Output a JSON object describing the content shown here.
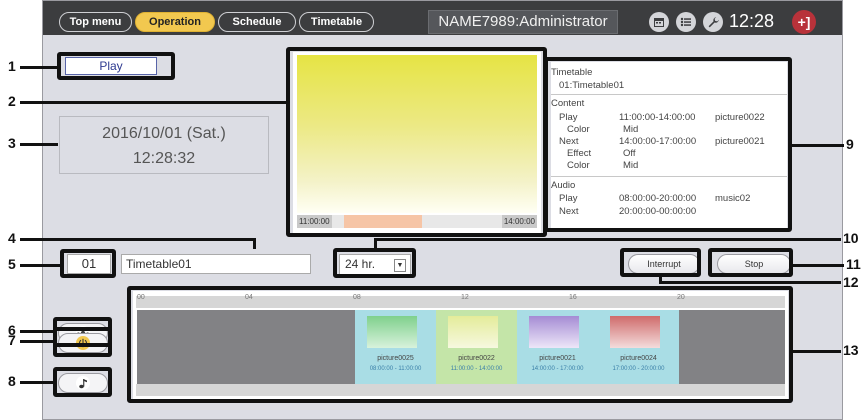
{
  "topbar": {
    "tabs": [
      {
        "label": "Top menu",
        "active": false
      },
      {
        "label": "Operation",
        "active": true
      },
      {
        "label": "Schedule",
        "active": false
      },
      {
        "label": "Timetable",
        "active": false
      }
    ],
    "user": "NAME7989:Administrator",
    "icons": [
      "calendar-icon",
      "list-icon",
      "wrench-icon"
    ],
    "time": "12:28",
    "exit_label": "+]"
  },
  "status": {
    "label": "Play"
  },
  "datetime": {
    "date": "2016/10/01 (Sat.)",
    "time": "12:28:32"
  },
  "preview": {
    "start": "11:00:00",
    "end": "14:00:00"
  },
  "info": {
    "timetable_label": "Timetable",
    "timetable_value": "01:Timetable01",
    "content_label": "Content",
    "content_play_label": "Play",
    "content_play_time": "11:00:00-14:00:00",
    "content_play_name": "picture0022",
    "content_color_label": "Color",
    "content_color_value": "Mid",
    "next_label": "Next",
    "next_time": "14:00:00-17:00:00",
    "next_name": "picture0021",
    "effect_label": "Effect",
    "effect_value": "Off",
    "next_color_label": "Color",
    "next_color_value": "Mid",
    "audio_label": "Audio",
    "audio_play_label": "Play",
    "audio_play_time": "08:00:00-20:00:00",
    "audio_play_name": "music02",
    "audio_next_label": "Next",
    "audio_next_time": "20:00:00-00:00:00"
  },
  "controls": {
    "timetable_number": "01",
    "timetable_name": "Timetable01",
    "hours": "24 hr.",
    "interrupt_label": "Interrupt",
    "stop_label": "Stop"
  },
  "schedule": {
    "hour_labels": [
      "00",
      "04",
      "08",
      "12",
      "16",
      "20"
    ],
    "items": [
      {
        "name": "picture0025",
        "time": "08:00:00 - 11:00:00",
        "color": "#7fd08c"
      },
      {
        "name": "picture0022",
        "time": "11:00:00 - 14:00:00",
        "color": "#e4ec9a"
      },
      {
        "name": "picture0021",
        "time": "14:00:00 - 17:00:00",
        "color": "#a58cd4"
      },
      {
        "name": "picture0024",
        "time": "17:00:00 - 20:00:00",
        "color": "#cf6b6b"
      }
    ]
  },
  "callouts": [
    "1",
    "2",
    "3",
    "4",
    "5",
    "6",
    "7",
    "8",
    "9",
    "10",
    "11",
    "12",
    "13"
  ]
}
